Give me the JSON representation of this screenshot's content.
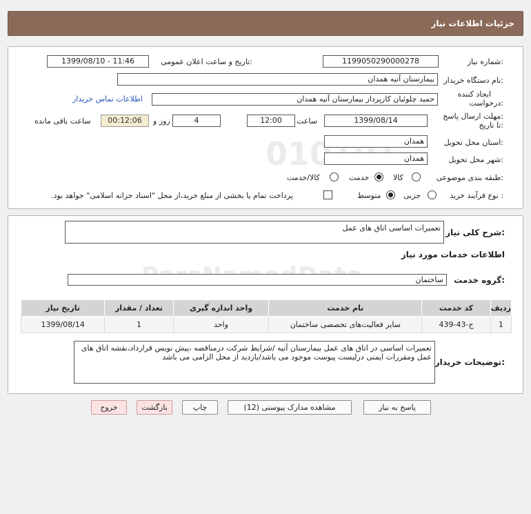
{
  "header": {
    "title": "جزئیات اطلاعات نیاز"
  },
  "form": {
    "need_number": {
      "label": "شماره نیاز:",
      "value": "1199050290000278"
    },
    "announce_datetime": {
      "label": "تاریخ و ساعت اعلان عمومی:",
      "value": "1399/08/10 - 11:46"
    },
    "buyer_org": {
      "label": "نام دستگاه خریدار:",
      "value": "بیمارستان آتیه همدان"
    },
    "requester": {
      "label_line1": "ایجاد کننده",
      "label_line2": "درخواست:",
      "value": "حمید چلوئیان  کارپرداز بیمارستان آتیه همدان"
    },
    "buyer_contact_link": "اطلاعات تماس خریدار",
    "deadline": {
      "label_line1": "مهلت ارسال پاسخ:",
      "label_line2": "تا تاریخ:",
      "date": "1399/08/14",
      "time_label": "ساعت",
      "time": "12:00",
      "days": "4",
      "days_label": "روز و",
      "remaining": "00:12:06",
      "remaining_label": "ساعت باقی مانده"
    },
    "province": {
      "label": "استان محل تحویل:",
      "value": "همدان"
    },
    "city": {
      "label": "شهر محل تحویل:",
      "value": "همدان"
    },
    "category": {
      "label": "طبقه بندی موضوعی:",
      "options": [
        "کالا",
        "خدمت",
        "کالا/خدمت"
      ],
      "selected": "خدمت"
    },
    "purchase_process": {
      "label": "نوع فرآیند خرید :",
      "options": [
        "جزیی",
        "متوسط"
      ],
      "selected": "متوسط",
      "payment_note": "پرداخت تمام یا بخشی از مبلغ خرید،از محل \"اسناد خزانه اسلامی\" خواهد بود."
    }
  },
  "details": {
    "general_desc_label": "شرح کلی نیاز:",
    "general_desc": "تعمیرات اساسی اتاق های عمل",
    "services_info_title": "اطلاعات خدمات مورد نیاز",
    "service_group_label": "گروه خدمت:",
    "service_group": "ساختمان",
    "table": {
      "headers": [
        "ردیف",
        "کد خدمت",
        "نام خدمت",
        "واحد اندازه گیری",
        "تعداد / مقدار",
        "تاریخ نیاز"
      ],
      "rows": [
        [
          "1",
          "ج-43-439",
          "سایر فعالیت‌های تخصصی ساختمان",
          "واحد",
          "1",
          "1399/08/14"
        ]
      ]
    },
    "buyer_notes_label": "توضیحات خریدار:",
    "buyer_notes": "تعمیرات اساسی در اتاق های عمل بیمارستان آتیه /شرایط شرکت درمناقصه ،پیش نویس قرارداد،نقشه اتاق های عمل ومقررات ایمنی درلیست پیوست موجود می باشد/بازدید از محل الزامی می باشد"
  },
  "buttons": {
    "reply": "پاسخ به نیاز",
    "attachments": "مشاهده مدارک پیوستی (12)",
    "print": "چاپ",
    "back": "بازگشت",
    "exit": "خروج"
  },
  "watermark": {
    "brand": "ParsNamadData",
    "number": "010101"
  },
  "colors": {
    "header": "#8a6a58",
    "remaining_bg": "#f3eccf",
    "link": "#2358b8",
    "red_button": "#fbe3e3"
  }
}
